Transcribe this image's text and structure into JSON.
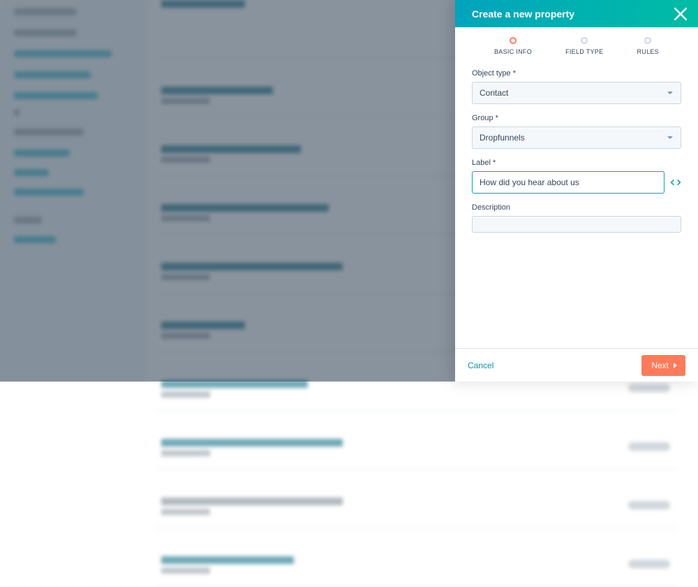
{
  "panel": {
    "title": "Create a new property",
    "steps": [
      {
        "label": "BASIC INFO",
        "active": true
      },
      {
        "label": "FIELD TYPE",
        "active": false
      },
      {
        "label": "RULES",
        "active": false
      }
    ],
    "objectType": {
      "label": "Object type *",
      "value": "Contact"
    },
    "group": {
      "label": "Group *",
      "value": "Dropfunnels"
    },
    "labelField": {
      "label": "Label *",
      "value": "How did you hear about us"
    },
    "description": {
      "label": "Description",
      "value": ""
    },
    "cancel": "Cancel",
    "next": "Next"
  }
}
